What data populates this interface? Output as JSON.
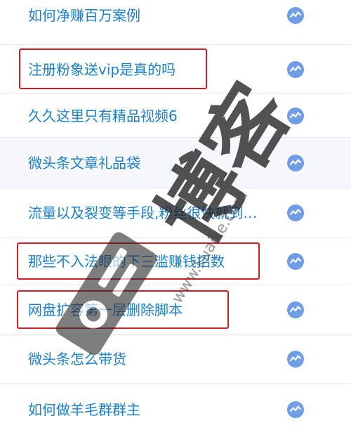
{
  "articles": [
    {
      "title": "如何净赚百万案例",
      "icon": "trend-line-icon"
    },
    {
      "title": "注册粉象送vip是真的吗",
      "icon": "trend-line-icon"
    },
    {
      "title": "久久这里只有精品视频6",
      "icon": "trend-line-icon"
    },
    {
      "title": "微头条文章礼品袋",
      "icon": "trend-line-icon"
    },
    {
      "title": "流量以及裂变等手段,粉丝很快就到…",
      "icon": "trend-line-icon"
    },
    {
      "title": "那些不入法眼的下三滥赚钱招数",
      "icon": "trend-line-icon"
    },
    {
      "title": "网盘扩容第一层删除脚本",
      "icon": "trend-line-icon"
    },
    {
      "title": "微头条怎么带货",
      "icon": "trend-line-icon"
    },
    {
      "title": "如何做羊毛群群主",
      "icon": "trend-line-icon"
    }
  ],
  "watermark": {
    "text": "博客",
    "url": "www.kuaike.com"
  },
  "colors": {
    "link": "#1c7fc9",
    "highlight": "#d11d2a",
    "icon_fill": "#6f9ee6",
    "row_alt_bg": "#f5f7fb"
  }
}
